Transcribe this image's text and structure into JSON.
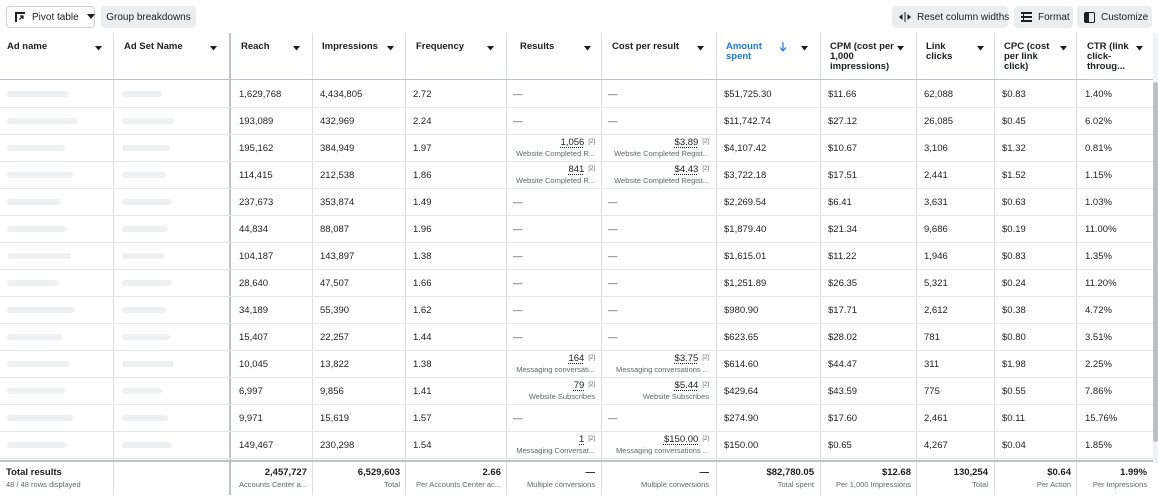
{
  "toolbar": {
    "pivot_label": "Pivot table",
    "group_label": "Group breakdowns",
    "reset_label": "Reset column widths",
    "format_label": "Format",
    "customize_label": "Customize"
  },
  "columns": [
    {
      "key": "ad_name",
      "label": "Ad name"
    },
    {
      "key": "ad_set",
      "label": "Ad Set Name"
    },
    {
      "key": "reach",
      "label": "Reach"
    },
    {
      "key": "impressions",
      "label": "Impressions"
    },
    {
      "key": "frequency",
      "label": "Frequency"
    },
    {
      "key": "results",
      "label": "Results"
    },
    {
      "key": "cpr",
      "label": "Cost per result"
    },
    {
      "key": "amount",
      "label": "Amount spent",
      "sort": "descending"
    },
    {
      "key": "cpm",
      "label": "CPM (cost per 1,000 impressions)"
    },
    {
      "key": "link_clicks",
      "label": "Link clicks"
    },
    {
      "key": "cpc",
      "label": "CPC (cost per link click)"
    },
    {
      "key": "ctr",
      "label": "CTR (link click-throug..."
    }
  ],
  "colors": {
    "accent": "#1877f2",
    "border": "#dadde1",
    "muted": "#606770"
  },
  "rows": [
    {
      "reach": "1,629,768",
      "impressions": "4,434,805",
      "frequency": "2.72",
      "results": {
        "value": "—"
      },
      "cpr": {
        "value": "—"
      },
      "amount": "$51,725.30",
      "cpm": "$11.66",
      "clicks": "62,088",
      "cpc": "$0.83",
      "ctr": "1.40%"
    },
    {
      "reach": "193,089",
      "impressions": "432,969",
      "frequency": "2.24",
      "results": {
        "value": "—"
      },
      "cpr": {
        "value": "—"
      },
      "amount": "$11,742.74",
      "cpm": "$27.12",
      "clicks": "26,085",
      "cpc": "$0.45",
      "ctr": "6.02%"
    },
    {
      "reach": "195,162",
      "impressions": "384,949",
      "frequency": "1.97",
      "results": {
        "value": "1,056",
        "sup": "[2]",
        "sub": "Website Completed R..."
      },
      "cpr": {
        "value": "$3.89",
        "sup": "[2]",
        "sub": "Website Completed Regist..."
      },
      "amount": "$4,107.42",
      "cpm": "$10.67",
      "clicks": "3,106",
      "cpc": "$1.32",
      "ctr": "0.81%"
    },
    {
      "reach": "114,415",
      "impressions": "212,538",
      "frequency": "1.86",
      "results": {
        "value": "841",
        "sup": "[2]",
        "sub": "Website Completed R..."
      },
      "cpr": {
        "value": "$4.43",
        "sup": "[2]",
        "sub": "Website Completed Regist..."
      },
      "amount": "$3,722.18",
      "cpm": "$17.51",
      "clicks": "2,441",
      "cpc": "$1.52",
      "ctr": "1.15%"
    },
    {
      "reach": "237,673",
      "impressions": "353,874",
      "frequency": "1.49",
      "results": {
        "value": "—"
      },
      "cpr": {
        "value": "—"
      },
      "amount": "$2,269.54",
      "cpm": "$6.41",
      "clicks": "3,631",
      "cpc": "$0.63",
      "ctr": "1.03%"
    },
    {
      "reach": "44,834",
      "impressions": "88,087",
      "frequency": "1.96",
      "results": {
        "value": "—"
      },
      "cpr": {
        "value": "—"
      },
      "amount": "$1,879.40",
      "cpm": "$21.34",
      "clicks": "9,686",
      "cpc": "$0.19",
      "ctr": "11.00%"
    },
    {
      "reach": "104,187",
      "impressions": "143,897",
      "frequency": "1.38",
      "results": {
        "value": "—"
      },
      "cpr": {
        "value": "—"
      },
      "amount": "$1,615.01",
      "cpm": "$11.22",
      "clicks": "1,946",
      "cpc": "$0.83",
      "ctr": "1.35%"
    },
    {
      "reach": "28,640",
      "impressions": "47,507",
      "frequency": "1.66",
      "results": {
        "value": "—"
      },
      "cpr": {
        "value": "—"
      },
      "amount": "$1,251.89",
      "cpm": "$26.35",
      "clicks": "5,321",
      "cpc": "$0.24",
      "ctr": "11.20%"
    },
    {
      "reach": "34,189",
      "impressions": "55,390",
      "frequency": "1.62",
      "results": {
        "value": "—"
      },
      "cpr": {
        "value": "—"
      },
      "amount": "$980.90",
      "cpm": "$17.71",
      "clicks": "2,612",
      "cpc": "$0.38",
      "ctr": "4.72%"
    },
    {
      "reach": "15,407",
      "impressions": "22,257",
      "frequency": "1.44",
      "results": {
        "value": "—"
      },
      "cpr": {
        "value": "—"
      },
      "amount": "$623.65",
      "cpm": "$28.02",
      "clicks": "781",
      "cpc": "$0.80",
      "ctr": "3.51%"
    },
    {
      "reach": "10,045",
      "impressions": "13,822",
      "frequency": "1.38",
      "results": {
        "value": "164",
        "sup": "[2]",
        "sub": "Messaging conversati..."
      },
      "cpr": {
        "value": "$3.75",
        "sup": "[2]",
        "sub": "Messaging conversations ..."
      },
      "amount": "$614.60",
      "cpm": "$44.47",
      "clicks": "311",
      "cpc": "$1.98",
      "ctr": "2.25%"
    },
    {
      "reach": "6,997",
      "impressions": "9,856",
      "frequency": "1.41",
      "results": {
        "value": "79",
        "sup": "[2]",
        "sub": "Website Subscribes"
      },
      "cpr": {
        "value": "$5.44",
        "sup": "[2]",
        "sub": "Website Subscribes"
      },
      "amount": "$429.64",
      "cpm": "$43.59",
      "clicks": "775",
      "cpc": "$0.55",
      "ctr": "7.86%"
    },
    {
      "reach": "9,971",
      "impressions": "15,619",
      "frequency": "1.57",
      "results": {
        "value": "—"
      },
      "cpr": {
        "value": "—"
      },
      "amount": "$274.90",
      "cpm": "$17.60",
      "clicks": "2,461",
      "cpc": "$0.11",
      "ctr": "15.76%"
    },
    {
      "reach": "149,467",
      "impressions": "230,298",
      "frequency": "1.54",
      "results": {
        "value": "1",
        "sup": "[2]",
        "sub": "Messaging Conversat..."
      },
      "cpr": {
        "value": "$150.00",
        "sup": "[2]",
        "sub": "Messaging conversations ..."
      },
      "amount": "$150.00",
      "cpm": "$0.65",
      "clicks": "4,267",
      "cpc": "$0.04",
      "ctr": "1.85%"
    }
  ],
  "totals": {
    "label": "Total results",
    "rows_displayed": "48 / 48 rows displayed",
    "reach": {
      "value": "2,457,727",
      "caption": "Accounts Center a..."
    },
    "impressions": {
      "value": "6,529,603",
      "caption": "Total"
    },
    "frequency": {
      "value": "2.66",
      "caption": "Per Accounts Center ac..."
    },
    "results": {
      "value": "—",
      "caption": "Multiple conversions"
    },
    "cpr": {
      "value": "—",
      "caption": "Multiple conversions"
    },
    "amount": {
      "value": "$82,780.05",
      "caption": "Total spent"
    },
    "cpm": {
      "value": "$12.68",
      "caption": "Per 1,000 Impressions"
    },
    "clicks": {
      "value": "130,254",
      "caption": "Total"
    },
    "cpc": {
      "value": "$0.64",
      "caption": "Per Action"
    },
    "ctr": {
      "value": "1.99%",
      "caption": "Per Impressions"
    }
  }
}
